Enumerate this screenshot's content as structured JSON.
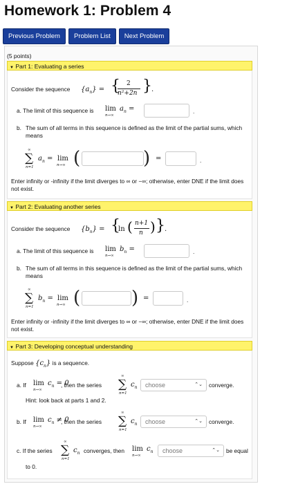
{
  "page": {
    "title": "Homework 1: Problem 4",
    "nav": [
      "Previous Problem",
      "Problem List",
      "Next Problem"
    ],
    "points": "(5 points)"
  },
  "part1": {
    "header": "Part 1: Evaluating a series",
    "intro": "Consider the sequence",
    "a_label": "a.",
    "a_text": "The limit of this sequence is",
    "b_label": "b.",
    "b_text": "The sum of all terms in this sequence is defined as the limit of the partial sums, which means",
    "note": "Enter infinity or -infinity if the limit diverges to ∞ or −∞; otherwise, enter DNE if the limit does not exist."
  },
  "part2": {
    "header": "Part 2: Evaluating another series",
    "intro": "Consider the sequence",
    "a_label": "a.",
    "a_text": "The limit of this sequence is",
    "b_label": "b.",
    "b_text": "The sum of all terms in this sequence is defined as the limit of the partial sums, which means",
    "note": "Enter infinity or -infinity if the limit diverges to ∞ or −∞; otherwise, enter DNE if the limit does not exist."
  },
  "part3": {
    "header": "Part 3: Developing conceptual understanding",
    "intro_pre": "Suppose",
    "intro_post": "is a sequence.",
    "a_label": "a.",
    "a_if": "If",
    "a_mid": ", then the series",
    "a_end": "converge.",
    "hint": "Hint: look back at parts 1 and 2.",
    "b_label": "b.",
    "b_if": "If",
    "b_mid": ", then the series",
    "b_end": "converge.",
    "c_label": "c.",
    "c_pre": "If the series",
    "c_mid": "converges, then",
    "c_end": "be equal",
    "c_end2": "to 0.",
    "select_placeholder": "choose"
  },
  "icons": {
    "collapse": "triangle-down-icon",
    "select_arrows": "updown-chevron-icon"
  },
  "colors": {
    "nav_button": "#1a3f9b",
    "part_header": "#fff36b"
  }
}
